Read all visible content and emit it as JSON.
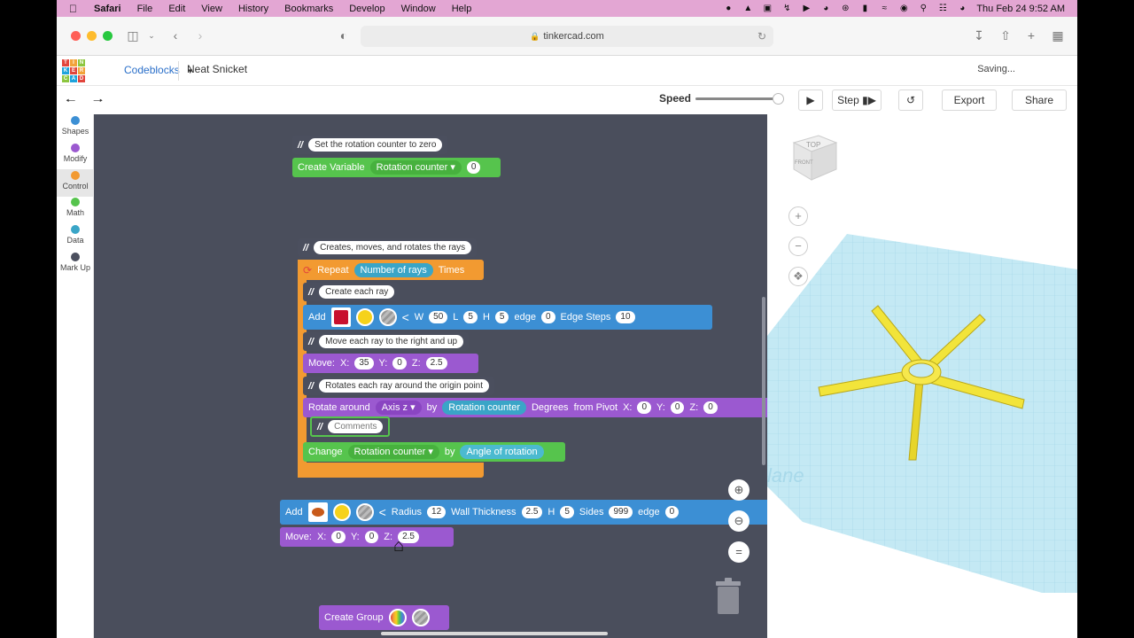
{
  "menubar": {
    "app": "Safari",
    "items": [
      "File",
      "Edit",
      "View",
      "History",
      "Bookmarks",
      "Develop",
      "Window",
      "Help"
    ],
    "clock": "Thu Feb 24  9:52 AM"
  },
  "browser": {
    "url": "tinkercad.com"
  },
  "header": {
    "logo_letters": [
      "T",
      "I",
      "N",
      "K",
      "E",
      "R",
      "C",
      "A",
      "D"
    ],
    "mode": "Codeblocks",
    "design_name": "Neat Snicket",
    "status": "Saving..."
  },
  "subbar": {
    "speed_label": "Speed",
    "speed_value": 1.0,
    "step_label": "Step",
    "export_label": "Export",
    "share_label": "Share"
  },
  "categories": [
    {
      "label": "Shapes",
      "color": "#3c8fd4"
    },
    {
      "label": "Modify",
      "color": "#9b59d0"
    },
    {
      "label": "Control",
      "color": "#f29a31"
    },
    {
      "label": "Math",
      "color": "#56c44d"
    },
    {
      "label": "Data",
      "color": "#3aa5c7"
    },
    {
      "label": "Mark Up",
      "color": "#4b4f5e"
    }
  ],
  "blocks": {
    "comment1": "Set the rotation counter to zero",
    "create_variable": "Create Variable",
    "rotation_counter": "Rotation counter",
    "zero": "0",
    "comment2": "Creates, moves, and rotates the rays",
    "repeat": "Repeat",
    "number_of_rays": "Number of rays",
    "times": "Times",
    "comment3": "Create each ray",
    "add": "Add",
    "w_label": "W",
    "w_val": "50",
    "l_label": "L",
    "l_val": "5",
    "h_label": "H",
    "h_val": "5",
    "edge_label": "edge",
    "edge_val": "0",
    "edge_steps_label": "Edge Steps",
    "edge_steps_val": "10",
    "comment4": "Move each ray to the right and up",
    "move": "Move:",
    "x_label": "X:",
    "y_label": "Y:",
    "z_label": "Z:",
    "move1_x": "35",
    "move1_y": "0",
    "move1_z": "2.5",
    "comment5": "Rotates each ray around the origin point",
    "rotate_around": "Rotate around",
    "axis_z": "Axis z",
    "by": "by",
    "degrees": "Degrees",
    "from_pivot": "from Pivot",
    "pivot_x": "0",
    "pivot_y": "0",
    "pivot_z": "0",
    "comments_placeholder": "Comments",
    "change": "Change",
    "angle_of_rotation": "Angle of rotation",
    "radius_label": "Radius",
    "radius_val": "12",
    "wall_label": "Wall Thickness",
    "wall_val": "2.5",
    "h2_val": "5",
    "sides_label": "Sides",
    "sides_val": "999",
    "edge2_label": "edge",
    "edge2_val": "0",
    "move2_x": "0",
    "move2_y": "0",
    "move2_z": "2.5",
    "create_group": "Create Group"
  },
  "viewer": {
    "cube_top": "TOP",
    "cube_front": "FRONT",
    "plane_text": "lane"
  },
  "colors": {
    "menubar": "#e3a6d3",
    "workspace": "#4a4e5c",
    "grid": "#b9e3f0",
    "model": "#f2e43a"
  }
}
